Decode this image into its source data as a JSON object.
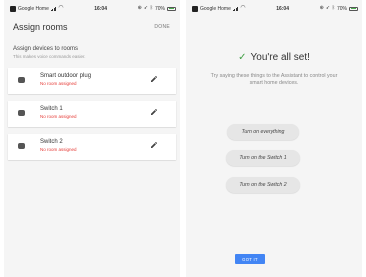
{
  "status_bar": {
    "app_name": "Google Home",
    "time": "16:04",
    "battery_text": "70%"
  },
  "assign_screen": {
    "title": "Assign rooms",
    "done_label": "DONE",
    "intro_heading": "Assign devices to rooms",
    "intro_subtext": "This makes voice commands easier.",
    "devices": [
      {
        "name": "Smart outdoor plug",
        "status": "No room assigned",
        "icon": "plug-icon"
      },
      {
        "name": "Switch 1",
        "status": "No room assigned",
        "icon": "switch-icon"
      },
      {
        "name": "Switch 2",
        "status": "No room assigned",
        "icon": "switch-icon"
      }
    ]
  },
  "success_screen": {
    "heading": "You're all set!",
    "assistant_text": "Try saying these things to the Assistant to control your smart home devices.",
    "suggestions": [
      "Turn on everything",
      "Turn on the Switch 1",
      "Turn on the Switch 2"
    ],
    "button_label": "GOT IT"
  },
  "colors": {
    "accent": "#4285f4",
    "success": "#43a047",
    "warning": "#e53935"
  }
}
